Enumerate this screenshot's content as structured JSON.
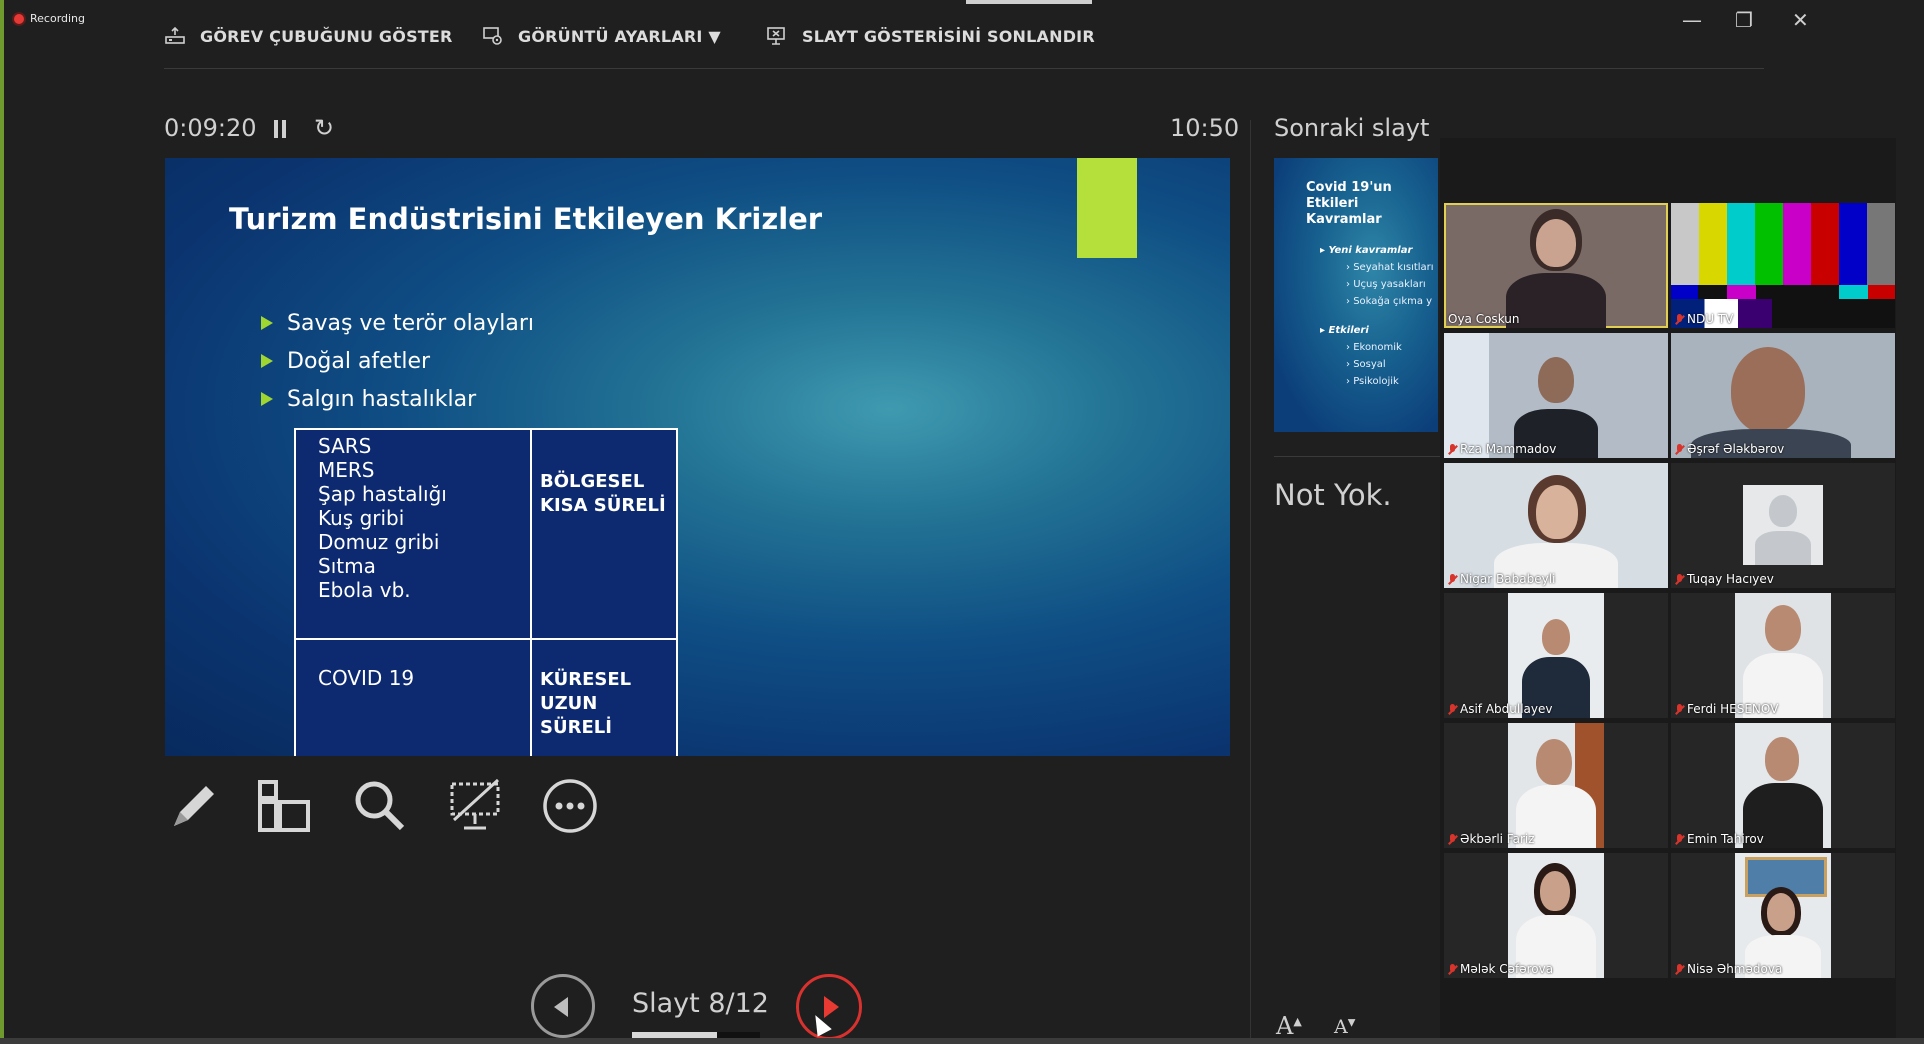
{
  "recording": {
    "label": "Recording"
  },
  "toolbar": {
    "show_taskbar": "GÖREV ÇUBUĞUNU GÖSTER",
    "display_settings": "GÖRÜNTÜ AYARLARI ▼",
    "end_slideshow": "SLAYT GÖSTERİSİNİ SONLANDIR"
  },
  "window_controls": {
    "minimize": "—",
    "restore": "❐",
    "close": "✕"
  },
  "presenter": {
    "elapsed": "0:09:20",
    "clock": "10:50",
    "next_label": "Sonraki slayt",
    "notes": "Not Yok.",
    "slide_counter": "Slayt 8/12",
    "progress_fraction": 0.667
  },
  "slide": {
    "title": "Turizm Endüstrisini Etkileyen Krizler",
    "bullets": [
      "Savaş ve terör olayları",
      "Doğal afetler",
      "Salgın hastalıklar"
    ],
    "table": {
      "row1_left": [
        "SARS",
        "MERS",
        "Şap hastalığı",
        "Kuş gribi",
        "Domuz gribi",
        "Sıtma",
        "Ebola vb."
      ],
      "row1_right": [
        "BÖLGESEL",
        "KISA SÜRELİ"
      ],
      "row2_left": "COVID 19",
      "row2_right": [
        "KÜRESEL",
        "UZUN SÜRELİ"
      ]
    },
    "accent_color": "#b5e03c"
  },
  "next_slide": {
    "title": "Covid 19'un Etkileri Kavramlar",
    "group1": "Yeni kavramlar",
    "group1_items": [
      "Seyahat kısıtları",
      "Uçuş yasakları",
      "Sokağa çıkma y"
    ],
    "group2": "Etkileri",
    "group2_items": [
      "Ekonomik",
      "Sosyal",
      "Psikolojik"
    ]
  },
  "font_buttons": {
    "increase": "A",
    "decrease": "A"
  },
  "participants": [
    {
      "name": "Oya Coskun",
      "muted": false,
      "active": true
    },
    {
      "name": "NDU TV",
      "muted": true
    },
    {
      "name": "Rza Mammadov",
      "muted": true
    },
    {
      "name": "Əşrəf Ələkbərov",
      "muted": true
    },
    {
      "name": "Nigar Bababeyli",
      "muted": true
    },
    {
      "name": "Tuqay Hacıyev",
      "muted": true
    },
    {
      "name": "Asif Abdullayev",
      "muted": true
    },
    {
      "name": "Ferdi HESENOV",
      "muted": true
    },
    {
      "name": "Əkbərli Fariz",
      "muted": true
    },
    {
      "name": "Emin Tahirov",
      "muted": true
    },
    {
      "name": "Mələk Cəfərova",
      "muted": true
    },
    {
      "name": "Nisə Əhmədova",
      "muted": true
    }
  ]
}
